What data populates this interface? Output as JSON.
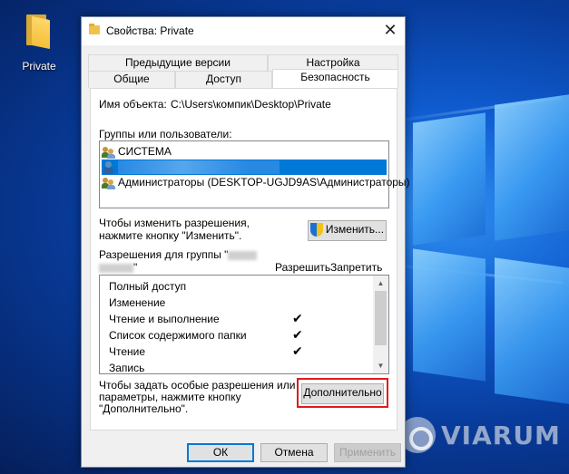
{
  "desktop": {
    "icon_label": "Private",
    "watermark": "VIARUM"
  },
  "dialog": {
    "title": "Свойства: Private",
    "close_glyph": "✕",
    "tabs_row1": [
      "Предыдущие версии",
      "Настройка"
    ],
    "tabs_row2": [
      "Общие",
      "Доступ",
      "Безопасность"
    ],
    "active_tab": "Безопасность",
    "object_name_label": "Имя объекта:",
    "object_name_value": "C:\\Users\\компик\\Desktop\\Private",
    "groups_label": "Группы или пользователи:",
    "groups": [
      {
        "name": "СИСТЕМА",
        "icon": "user-group-icon",
        "selected": false
      },
      {
        "name": "",
        "icon": "user-icon",
        "selected": true
      },
      {
        "name": "Администраторы (DESKTOP-UGJD9AS\\Администраторы)",
        "icon": "user-group-icon",
        "selected": false
      }
    ],
    "change_hint": "Чтобы изменить разрешения,\nнажмите кнопку \"Изменить\".",
    "change_button": "Изменить...",
    "perm_label_prefix": "Разрешения для группы \"",
    "perm_label_suffix": "\"",
    "allow_header": "Разрешить",
    "deny_header": "Запретить",
    "permissions": [
      {
        "name": "Полный доступ",
        "allow": false,
        "deny": false
      },
      {
        "name": "Изменение",
        "allow": false,
        "deny": false
      },
      {
        "name": "Чтение и выполнение",
        "allow": true,
        "deny": false
      },
      {
        "name": "Список содержимого папки",
        "allow": true,
        "deny": false
      },
      {
        "name": "Чтение",
        "allow": true,
        "deny": false
      },
      {
        "name": "Запись",
        "allow": false,
        "deny": false
      }
    ],
    "check_glyph": "✔",
    "advanced_hint": "Чтобы задать особые разрешения или\nпараметры, нажмите кнопку\n\"Дополнительно\".",
    "advanced_button": "Дополнительно",
    "ok_button": "ОК",
    "cancel_button": "Отмена",
    "apply_button": "Применить",
    "scroll_up": "▲",
    "scroll_down": "▼",
    "highlight_color": "#e01b1b",
    "selection_color": "#0078d7"
  }
}
